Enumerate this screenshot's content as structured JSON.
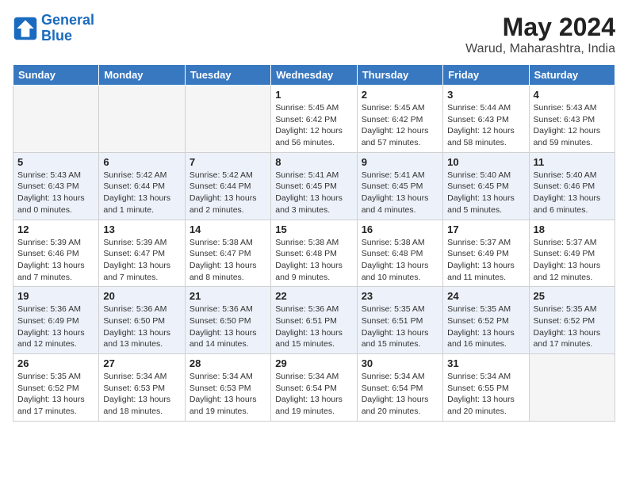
{
  "header": {
    "logo_line1": "General",
    "logo_line2": "Blue",
    "month_year": "May 2024",
    "location": "Warud, Maharashtra, India"
  },
  "weekdays": [
    "Sunday",
    "Monday",
    "Tuesday",
    "Wednesday",
    "Thursday",
    "Friday",
    "Saturday"
  ],
  "weeks": [
    [
      {
        "day": "",
        "info": ""
      },
      {
        "day": "",
        "info": ""
      },
      {
        "day": "",
        "info": ""
      },
      {
        "day": "1",
        "info": "Sunrise: 5:45 AM\nSunset: 6:42 PM\nDaylight: 12 hours\nand 56 minutes."
      },
      {
        "day": "2",
        "info": "Sunrise: 5:45 AM\nSunset: 6:42 PM\nDaylight: 12 hours\nand 57 minutes."
      },
      {
        "day": "3",
        "info": "Sunrise: 5:44 AM\nSunset: 6:43 PM\nDaylight: 12 hours\nand 58 minutes."
      },
      {
        "day": "4",
        "info": "Sunrise: 5:43 AM\nSunset: 6:43 PM\nDaylight: 12 hours\nand 59 minutes."
      }
    ],
    [
      {
        "day": "5",
        "info": "Sunrise: 5:43 AM\nSunset: 6:43 PM\nDaylight: 13 hours\nand 0 minutes."
      },
      {
        "day": "6",
        "info": "Sunrise: 5:42 AM\nSunset: 6:44 PM\nDaylight: 13 hours\nand 1 minute."
      },
      {
        "day": "7",
        "info": "Sunrise: 5:42 AM\nSunset: 6:44 PM\nDaylight: 13 hours\nand 2 minutes."
      },
      {
        "day": "8",
        "info": "Sunrise: 5:41 AM\nSunset: 6:45 PM\nDaylight: 13 hours\nand 3 minutes."
      },
      {
        "day": "9",
        "info": "Sunrise: 5:41 AM\nSunset: 6:45 PM\nDaylight: 13 hours\nand 4 minutes."
      },
      {
        "day": "10",
        "info": "Sunrise: 5:40 AM\nSunset: 6:45 PM\nDaylight: 13 hours\nand 5 minutes."
      },
      {
        "day": "11",
        "info": "Sunrise: 5:40 AM\nSunset: 6:46 PM\nDaylight: 13 hours\nand 6 minutes."
      }
    ],
    [
      {
        "day": "12",
        "info": "Sunrise: 5:39 AM\nSunset: 6:46 PM\nDaylight: 13 hours\nand 7 minutes."
      },
      {
        "day": "13",
        "info": "Sunrise: 5:39 AM\nSunset: 6:47 PM\nDaylight: 13 hours\nand 7 minutes."
      },
      {
        "day": "14",
        "info": "Sunrise: 5:38 AM\nSunset: 6:47 PM\nDaylight: 13 hours\nand 8 minutes."
      },
      {
        "day": "15",
        "info": "Sunrise: 5:38 AM\nSunset: 6:48 PM\nDaylight: 13 hours\nand 9 minutes."
      },
      {
        "day": "16",
        "info": "Sunrise: 5:38 AM\nSunset: 6:48 PM\nDaylight: 13 hours\nand 10 minutes."
      },
      {
        "day": "17",
        "info": "Sunrise: 5:37 AM\nSunset: 6:49 PM\nDaylight: 13 hours\nand 11 minutes."
      },
      {
        "day": "18",
        "info": "Sunrise: 5:37 AM\nSunset: 6:49 PM\nDaylight: 13 hours\nand 12 minutes."
      }
    ],
    [
      {
        "day": "19",
        "info": "Sunrise: 5:36 AM\nSunset: 6:49 PM\nDaylight: 13 hours\nand 12 minutes."
      },
      {
        "day": "20",
        "info": "Sunrise: 5:36 AM\nSunset: 6:50 PM\nDaylight: 13 hours\nand 13 minutes."
      },
      {
        "day": "21",
        "info": "Sunrise: 5:36 AM\nSunset: 6:50 PM\nDaylight: 13 hours\nand 14 minutes."
      },
      {
        "day": "22",
        "info": "Sunrise: 5:36 AM\nSunset: 6:51 PM\nDaylight: 13 hours\nand 15 minutes."
      },
      {
        "day": "23",
        "info": "Sunrise: 5:35 AM\nSunset: 6:51 PM\nDaylight: 13 hours\nand 15 minutes."
      },
      {
        "day": "24",
        "info": "Sunrise: 5:35 AM\nSunset: 6:52 PM\nDaylight: 13 hours\nand 16 minutes."
      },
      {
        "day": "25",
        "info": "Sunrise: 5:35 AM\nSunset: 6:52 PM\nDaylight: 13 hours\nand 17 minutes."
      }
    ],
    [
      {
        "day": "26",
        "info": "Sunrise: 5:35 AM\nSunset: 6:52 PM\nDaylight: 13 hours\nand 17 minutes."
      },
      {
        "day": "27",
        "info": "Sunrise: 5:34 AM\nSunset: 6:53 PM\nDaylight: 13 hours\nand 18 minutes."
      },
      {
        "day": "28",
        "info": "Sunrise: 5:34 AM\nSunset: 6:53 PM\nDaylight: 13 hours\nand 19 minutes."
      },
      {
        "day": "29",
        "info": "Sunrise: 5:34 AM\nSunset: 6:54 PM\nDaylight: 13 hours\nand 19 minutes."
      },
      {
        "day": "30",
        "info": "Sunrise: 5:34 AM\nSunset: 6:54 PM\nDaylight: 13 hours\nand 20 minutes."
      },
      {
        "day": "31",
        "info": "Sunrise: 5:34 AM\nSunset: 6:55 PM\nDaylight: 13 hours\nand 20 minutes."
      },
      {
        "day": "",
        "info": ""
      }
    ]
  ]
}
